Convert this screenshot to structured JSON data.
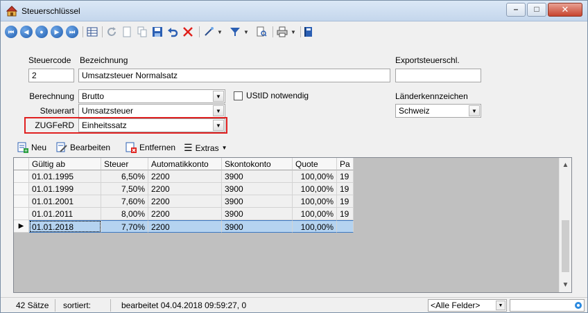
{
  "window": {
    "title": "Steuerschlüssel",
    "minimize": "–",
    "maximize": "□",
    "close": "✕"
  },
  "form": {
    "steuercode_label": "Steuercode",
    "steuercode_value": "2",
    "bezeichnung_label": "Bezeichnung",
    "bezeichnung_value": "Umsatzsteuer Normalsatz",
    "exportsteuerschl_label": "Exportsteuerschl.",
    "exportsteuerschl_value": "",
    "berechnung_label": "Berechnung",
    "berechnung_value": "Brutto",
    "ustid_label": "UStID notwendig",
    "steuerart_label": "Steuerart",
    "steuerart_value": "Umsatzsteuer",
    "zugferd_label": "ZUGFeRD",
    "zugferd_value": "Einheitssatz",
    "laenderkennzeichen_label": "Länderkennzeichen",
    "laenderkennzeichen_value": "Schweiz"
  },
  "gridbar": {
    "neu": "Neu",
    "bearbeiten": "Bearbeiten",
    "entfernen": "Entfernen",
    "extras": "Extras"
  },
  "grid": {
    "columns": [
      "Gültig ab",
      "Steuer",
      "Automatikkonto",
      "Skontokonto",
      "Quote",
      "Pa"
    ],
    "rows": [
      [
        "01.01.1995",
        "6,50%",
        "2200",
        "3900",
        "100,00%",
        "19"
      ],
      [
        "01.01.1999",
        "7,50%",
        "2200",
        "3900",
        "100,00%",
        "19"
      ],
      [
        "01.01.2001",
        "7,60%",
        "2200",
        "3900",
        "100,00%",
        "19"
      ],
      [
        "01.01.2011",
        "8,00%",
        "2200",
        "3900",
        "100,00%",
        "19"
      ],
      [
        "01.01.2018",
        "7,70%",
        "2200",
        "3900",
        "100,00%",
        ""
      ]
    ],
    "selected_row": 4
  },
  "statusbar": {
    "count": "42 Sätze",
    "sort": "sortiert:",
    "edited": "bearbeitet 04.04.2018 09:59:27,  0",
    "filter": "<Alle Felder>",
    "search": ""
  },
  "colors": {
    "accent": "#1f5cae",
    "highlight_border": "#e02020",
    "selected_row": "#b5d3f0"
  }
}
